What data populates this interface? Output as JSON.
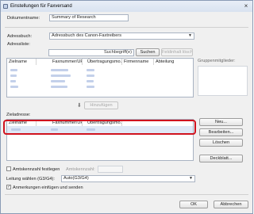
{
  "window": {
    "title": "Einstellungen für Faxversand",
    "close_glyph": "×"
  },
  "form": {
    "document_name_label": "Dokumentname:",
    "document_name_value": "Summary of Research",
    "address_book_label": "Adressbuch:",
    "address_book_value": "Adressbuch des Canon-Faxtreibers",
    "address_list_label": "Adressliste:",
    "search_placeholder": "Suchbegriff(e)",
    "search_button": "Suchen",
    "clear_search_button": "Feldinhalt löschen"
  },
  "address_list": {
    "columns": [
      "Zielname",
      "Faxnummer/URI",
      "Übertragungsmo...",
      "Firmenname",
      "Abteilung"
    ],
    "rows": 4
  },
  "group_members_label": "Gruppenmitglieder:",
  "add_button": "Hinzufügen",
  "recipient": {
    "label": "Zieladresse:",
    "columns": [
      "Zielname",
      "Faxnummer/URI",
      "Übertragungsmo..."
    ],
    "rows": 1
  },
  "side_buttons": {
    "new": "Neu...",
    "edit": "Bearbeiten...",
    "delete": "Löschen",
    "cover_sheet": "Deckblatt..."
  },
  "options": {
    "outside_line_label": "Amtskennzahl festlegen",
    "outside_line_code_label": "Amtskennzahl:",
    "line_select_label": "Leitung wählen (G3/G4):",
    "line_select_value": "Auto(G3/G4)",
    "confirm_label": "Anmerkungen einfügen und senden",
    "confirm_checked": "✓"
  },
  "footer": {
    "ok": "OK",
    "cancel": "Abbrechen"
  },
  "colors": {
    "highlight": "#d0131f",
    "blurred_text": "#b8c8e6"
  }
}
